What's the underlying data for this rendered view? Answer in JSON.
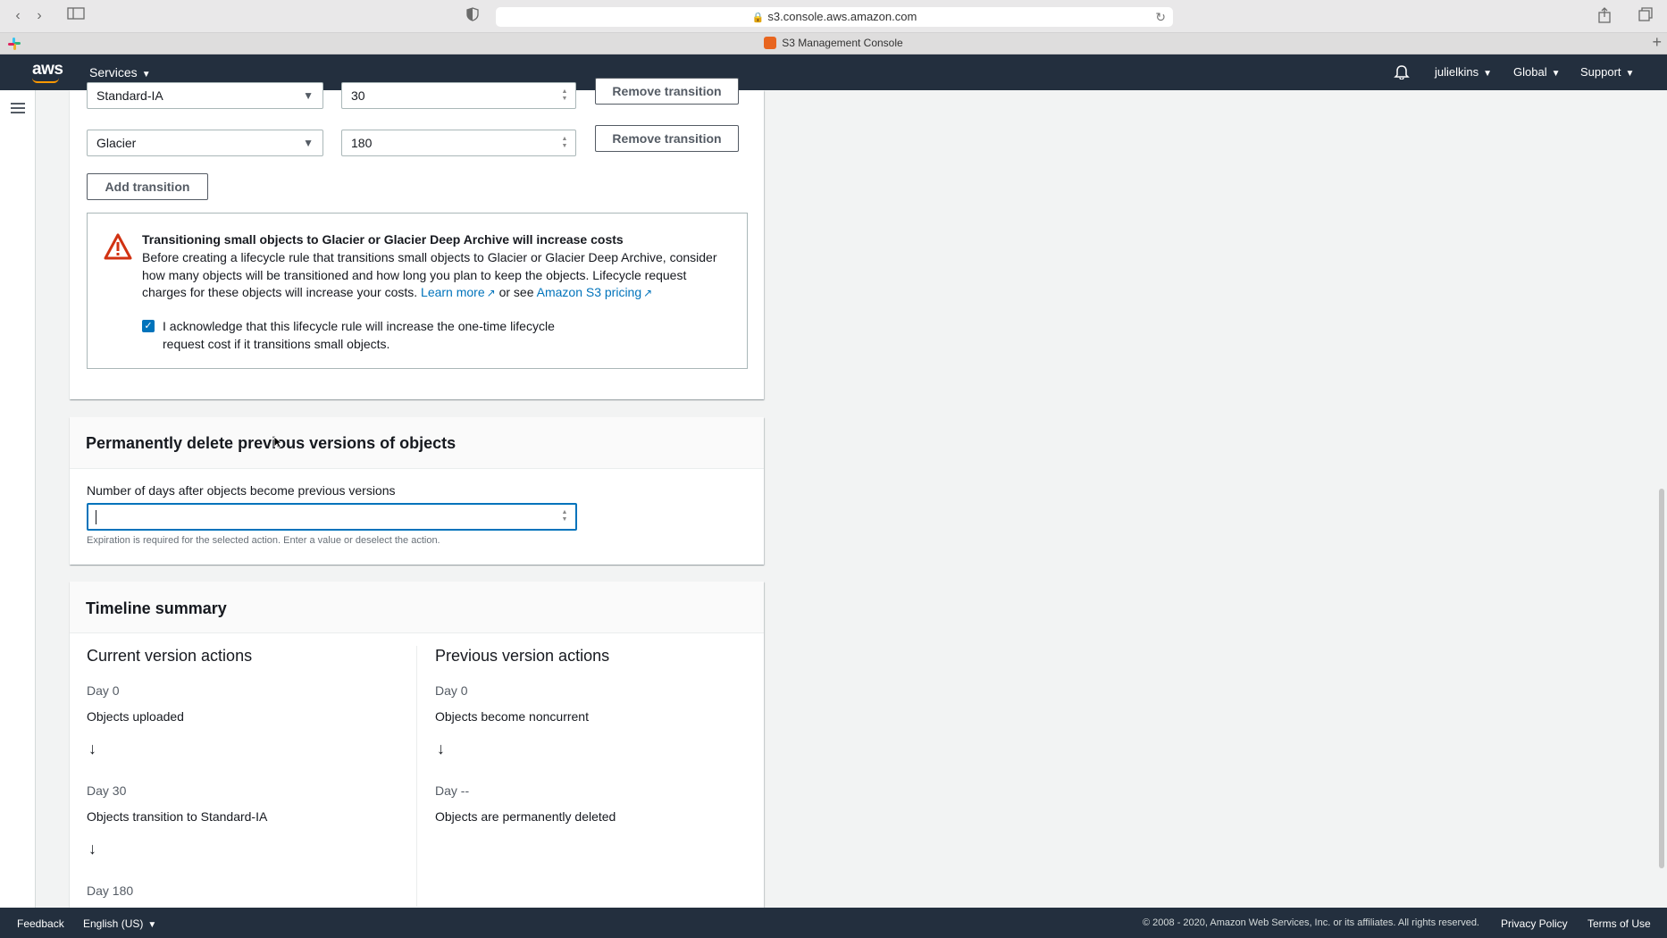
{
  "browser": {
    "url": "s3.console.aws.amazon.com",
    "tab_title": "S3 Management Console"
  },
  "nav": {
    "logo": "aws",
    "services": "Services",
    "user": "julielkins",
    "region": "Global",
    "support": "Support"
  },
  "transitions": [
    {
      "storage_class": "Standard-IA",
      "days": "30",
      "remove_label": "Remove transition"
    },
    {
      "storage_class": "Glacier",
      "days": "180",
      "remove_label": "Remove transition"
    }
  ],
  "add_transition_label": "Add transition",
  "alert": {
    "title": "Transitioning small objects to Glacier or Glacier Deep Archive will increase costs",
    "body": "Before creating a lifecycle rule that transitions small objects to Glacier or Glacier Deep Archive, consider how many objects will be transitioned and how long you plan to keep the objects. Lifecycle request charges for these objects will increase your costs.",
    "learn_more": "Learn more",
    "or_see": "or see",
    "pricing_link": "Amazon S3 pricing",
    "acknowledge": "I acknowledge that this lifecycle rule will increase the one-time lifecycle request cost if it transitions small objects.",
    "acknowledge_checked": true
  },
  "permanent_delete": {
    "title": "Permanently delete previous versions of objects",
    "field_label": "Number of days after objects become previous versions",
    "value": "",
    "hint": "Expiration is required for the selected action. Enter a value or deselect the action."
  },
  "timeline": {
    "title": "Timeline summary",
    "current_title": "Current version actions",
    "previous_title": "Previous version actions",
    "current": [
      {
        "day": "Day 0",
        "event": "Objects uploaded"
      },
      {
        "day": "Day 30",
        "event": "Objects transition to Standard-IA"
      },
      {
        "day": "Day 180",
        "event": ""
      }
    ],
    "previous": [
      {
        "day": "Day 0",
        "event": "Objects become noncurrent"
      },
      {
        "day": "Day --",
        "event": "Objects are permanently deleted"
      }
    ]
  },
  "footer": {
    "feedback": "Feedback",
    "language": "English (US)",
    "copyright": "© 2008 - 2020, Amazon Web Services, Inc. or its affiliates. All rights reserved.",
    "privacy": "Privacy Policy",
    "terms": "Terms of Use"
  },
  "colors": {
    "nav_bg": "#232f3e",
    "link": "#0073bb",
    "warning": "#d13212"
  }
}
